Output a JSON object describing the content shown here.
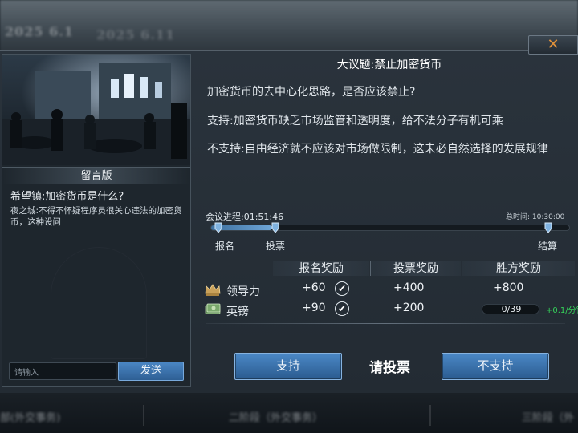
{
  "background": {
    "date_left": "2025 6.1",
    "date_right": "2025 6.11",
    "bottom_tabs": [
      "部(外交事务)",
      "二阶段（外交事务）",
      "三阶段（外"
    ]
  },
  "dialog": {
    "close_icon": "close-x-icon",
    "left_panel": {
      "board_title": "留言版",
      "message_title": "希望镇:加密货币是什么?",
      "message_body": "夜之城:不得不怀疑程序员很关心违法的加密货币，这种设问",
      "input_placeholder": "请输入",
      "send_label": "发送"
    },
    "topic": {
      "title": "大议题:禁止加密货币",
      "question": "加密货币的去中心化思路，是否应该禁止?",
      "support_statement": "支持:加密货币缺乏市场监管和透明度，给不法分子有机可乘",
      "oppose_statement": "不支持:自由经济就不应该对市场做限制，这未必自然选择的发展规律"
    },
    "progress": {
      "label": "会议进程:01:51:46",
      "total_time": "总时间: 10:30:00",
      "fill_fraction": 0.17,
      "stages": [
        "报名",
        "投票",
        "结算"
      ]
    },
    "rewards": {
      "headers": [
        "报名奖励",
        "投票奖励",
        "胜方奖励"
      ],
      "rows": [
        {
          "icon": "crown-icon",
          "label": "领导力",
          "signup": "+60",
          "signup_done": true,
          "vote": "+400",
          "win": "+800"
        },
        {
          "icon": "money-icon",
          "label": "英镑",
          "signup": "+90",
          "signup_done": true,
          "vote": "+200",
          "win": "0/39",
          "win_rate": "+0.1/分钟"
        }
      ]
    },
    "vote": {
      "support_label": "支持",
      "prompt": "请投票",
      "oppose_label": "不支持"
    }
  }
}
